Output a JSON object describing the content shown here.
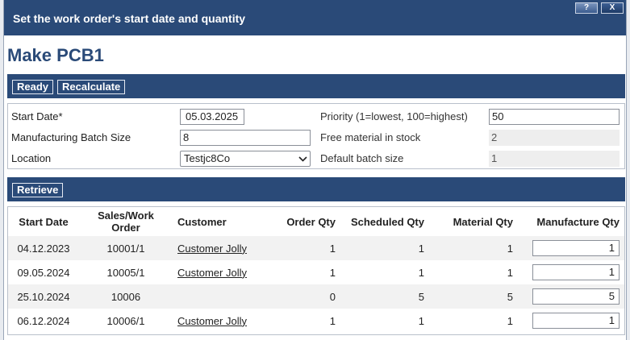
{
  "window": {
    "title": "Set the work order's start date and quantity",
    "help_label": "?",
    "close_label": "X"
  },
  "page_title": "Make PCB1",
  "toolbar": {
    "ready_label": "Ready",
    "recalculate_label": "Recalculate"
  },
  "form": {
    "start_date_label": "Start Date*",
    "start_date_value": "05.03.2025",
    "batch_size_label": "Manufacturing Batch Size",
    "batch_size_value": "8",
    "location_label": "Location",
    "location_value": "Testjc8Co",
    "priority_label": "Priority (1=lowest, 100=highest)",
    "priority_value": "50",
    "free_material_label": "Free material in stock",
    "free_material_value": "2",
    "default_batch_label": "Default batch size",
    "default_batch_value": "1"
  },
  "retrieve_label": "Retrieve",
  "table": {
    "headers": {
      "start_date": "Start Date",
      "order": "Sales/Work Order",
      "customer": "Customer",
      "order_qty": "Order Qty",
      "scheduled_qty": "Scheduled Qty",
      "material_qty": "Material Qty",
      "manufacture_qty": "Manufacture Qty"
    },
    "rows": [
      {
        "start_date": "04.12.2023",
        "order": "10001/1",
        "customer": "Customer Jolly",
        "order_qty": "1",
        "scheduled_qty": "1",
        "material_qty": "1",
        "manufacture_qty": "1"
      },
      {
        "start_date": "09.05.2024",
        "order": "10005/1",
        "customer": "Customer Jolly",
        "order_qty": "1",
        "scheduled_qty": "1",
        "material_qty": "1",
        "manufacture_qty": "1"
      },
      {
        "start_date": "25.10.2024",
        "order": "10006",
        "customer": "",
        "order_qty": "0",
        "scheduled_qty": "5",
        "material_qty": "5",
        "manufacture_qty": "5"
      },
      {
        "start_date": "06.12.2024",
        "order": "10006/1",
        "customer": "Customer Jolly",
        "order_qty": "1",
        "scheduled_qty": "1",
        "material_qty": "1",
        "manufacture_qty": "1"
      }
    ]
  },
  "colors": {
    "header_bar": "#2a4a78",
    "title_text": "#2a4a78",
    "alt_row": "#f2f2f2"
  }
}
